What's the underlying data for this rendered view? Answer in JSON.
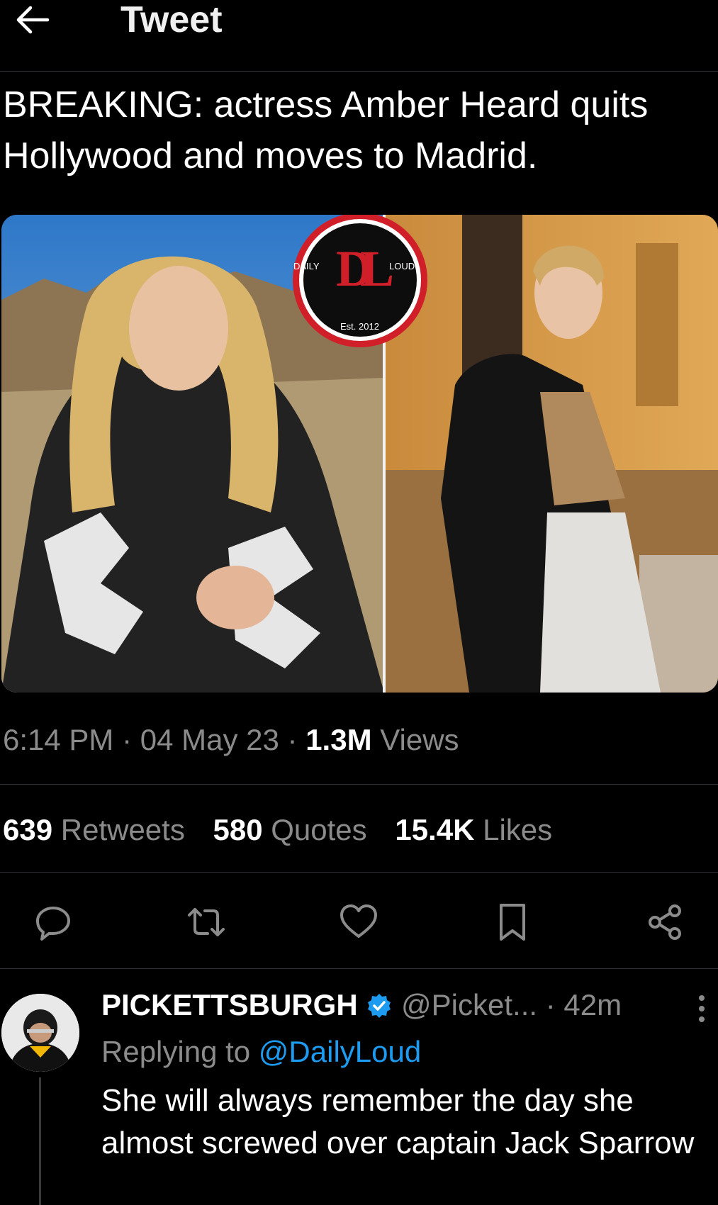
{
  "header": {
    "title": "Tweet"
  },
  "tweet": {
    "text": "BREAKING: actress Amber Heard quits Hollywood and moves to Madrid.",
    "media": {
      "logo_left": "DAILY",
      "logo_right": "LOUD",
      "logo_est": "Est. 2012",
      "logo_mark": "DL"
    },
    "time": "6:14 PM",
    "date": "04 May 23",
    "views_count": "1.3M",
    "views_label": "Views",
    "retweets_count": "639",
    "retweets_label": "Retweets",
    "quotes_count": "580",
    "quotes_label": "Quotes",
    "likes_count": "15.4K",
    "likes_label": "Likes"
  },
  "actions": [
    "reply-icon",
    "retweet-icon",
    "like-icon",
    "bookmark-icon",
    "share-icon"
  ],
  "reply": {
    "name": "PICKETTSBURGH",
    "handle": "@Picket...",
    "time": "· 42m",
    "replying_prefix": "Replying to",
    "replying_handle": "@DailyLoud",
    "text": "She will always remember the day she almost screwed over captain Jack Sparrow"
  },
  "colors": {
    "background": "#000000",
    "accent": "#1d9bf0",
    "muted": "#8b8b8b",
    "divider": "#2f3336"
  }
}
